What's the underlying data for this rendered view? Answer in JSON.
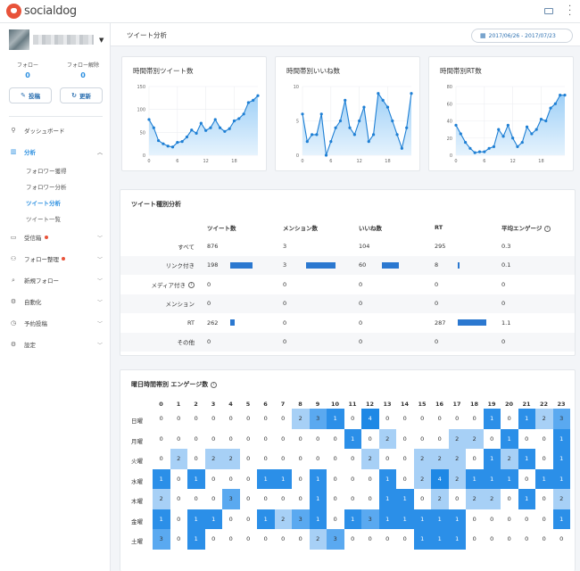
{
  "app": {
    "logo_text": "socialdog"
  },
  "topbar": {
    "icons": [
      "keyboard-icon",
      "more-vertical-icon"
    ]
  },
  "profile": {
    "name": ""
  },
  "stats": [
    {
      "label": "フォロー",
      "value": "0"
    },
    {
      "label": "フォロー解除",
      "value": "0"
    }
  ],
  "actions": {
    "post_label": "投稿",
    "refresh_label": "更新"
  },
  "nav": {
    "dashboard": "ダッシュボード",
    "analysis": "分析",
    "sub": [
      "フォロワー獲得",
      "フォロワー分析",
      "ツイート分析",
      "ツイート一覧"
    ],
    "inbox": "受信箱",
    "follow_manage": "フォロー整理",
    "new_follow": "新規フォロー",
    "automation": "自動化",
    "scheduled": "予約投稿",
    "settings": "設定"
  },
  "header": {
    "title": "ツイート分析",
    "date_range": "2017/06/26 - 2017/07/23"
  },
  "charts_meta": [
    {
      "title": "時間帯別ツイート数",
      "ylim": [
        0,
        150
      ],
      "yticks": [
        0,
        50,
        100,
        150
      ]
    },
    {
      "title": "時間帯別いいね数",
      "ylim": [
        0,
        10
      ],
      "yticks": [
        0,
        5,
        10
      ]
    },
    {
      "title": "時間帯別RT数",
      "ylim": [
        0,
        80
      ],
      "yticks": [
        0,
        20,
        40,
        60,
        80
      ]
    }
  ],
  "chart_data": [
    {
      "type": "area",
      "title": "時間帯別ツイート数",
      "xticks": [
        0,
        6,
        12,
        18
      ],
      "ylim": [
        0,
        150
      ],
      "x": [
        0,
        1,
        2,
        3,
        4,
        5,
        6,
        7,
        8,
        9,
        10,
        11,
        12,
        13,
        14,
        15,
        16,
        17,
        18,
        19,
        20,
        21,
        22,
        23
      ],
      "y": [
        78,
        60,
        32,
        25,
        20,
        18,
        28,
        30,
        40,
        55,
        48,
        70,
        54,
        60,
        78,
        60,
        52,
        58,
        75,
        80,
        90,
        115,
        120,
        130
      ]
    },
    {
      "type": "area",
      "title": "時間帯別いいね数",
      "xticks": [
        0,
        6,
        12,
        18
      ],
      "ylim": [
        0,
        10
      ],
      "x": [
        0,
        1,
        2,
        3,
        4,
        5,
        6,
        7,
        8,
        9,
        10,
        11,
        12,
        13,
        14,
        15,
        16,
        17,
        18,
        19,
        20,
        21,
        22,
        23
      ],
      "y": [
        6,
        2,
        3,
        3,
        6,
        0,
        2,
        4,
        5,
        8,
        4,
        3,
        5,
        7,
        2,
        3,
        9,
        8,
        7,
        5,
        3,
        1,
        4,
        9
      ]
    },
    {
      "type": "area",
      "title": "時間帯別RT数",
      "xticks": [
        0,
        6,
        12,
        18
      ],
      "ylim": [
        0,
        80
      ],
      "x": [
        0,
        1,
        2,
        3,
        4,
        5,
        6,
        7,
        8,
        9,
        10,
        11,
        12,
        13,
        14,
        15,
        16,
        17,
        18,
        19,
        20,
        21,
        22,
        23
      ],
      "y": [
        35,
        25,
        15,
        8,
        3,
        4,
        4,
        8,
        10,
        30,
        22,
        35,
        20,
        10,
        15,
        33,
        25,
        30,
        42,
        40,
        55,
        60,
        70,
        70
      ]
    }
  ],
  "type_table": {
    "title": "ツイート種別分析",
    "columns": [
      "ツイート数",
      "メンション数",
      "いいね数",
      "RT",
      "平均エンゲージ"
    ],
    "rows": [
      {
        "label": "すべて",
        "values": [
          "876",
          "3",
          "104",
          "295",
          "0.3"
        ],
        "bars": [
          0,
          0,
          0,
          0
        ]
      },
      {
        "label": "リンク付き",
        "values": [
          "198",
          "3",
          "60",
          "8",
          "0.1"
        ],
        "bars": [
          0.75,
          1,
          0.58,
          0.03
        ]
      },
      {
        "label": "メディア付き",
        "info": true,
        "values": [
          "0",
          "0",
          "0",
          "0",
          "0"
        ],
        "bars": [
          0,
          0,
          0,
          0
        ]
      },
      {
        "label": "メンション",
        "values": [
          "0",
          "0",
          "0",
          "0",
          "0"
        ],
        "bars": [
          0,
          0,
          0,
          0
        ]
      },
      {
        "label": "RT",
        "values": [
          "262",
          "0",
          "0",
          "287",
          "1.1"
        ],
        "bars": [
          0.16,
          0,
          0,
          0.97
        ]
      },
      {
        "label": "その他",
        "values": [
          "0",
          "0",
          "0",
          "0",
          "0"
        ],
        "bars": [
          0,
          0,
          0,
          0
        ]
      }
    ]
  },
  "heatmap": {
    "title": "曜日時間帯別 エンゲージ数",
    "hours": [
      "0",
      "1",
      "2",
      "3",
      "4",
      "5",
      "6",
      "7",
      "8",
      "9",
      "10",
      "11",
      "12",
      "13",
      "14",
      "15",
      "16",
      "17",
      "18",
      "19",
      "20",
      "21",
      "22",
      "23"
    ],
    "days": [
      "日曜",
      "月曜",
      "火曜",
      "水曜",
      "木曜",
      "金曜",
      "土曜"
    ],
    "values": [
      [
        0,
        0,
        0,
        0,
        0,
        0,
        0,
        0,
        2,
        3,
        1,
        0,
        4,
        0,
        0,
        0,
        0,
        0,
        0,
        1,
        0,
        1,
        2,
        3
      ],
      [
        0,
        0,
        0,
        0,
        0,
        0,
        0,
        0,
        0,
        0,
        0,
        1,
        0,
        2,
        0,
        0,
        0,
        2,
        2,
        0,
        1,
        0,
        0,
        1
      ],
      [
        0,
        2,
        0,
        2,
        2,
        0,
        0,
        0,
        0,
        0,
        0,
        0,
        2,
        0,
        0,
        2,
        2,
        2,
        0,
        1,
        2,
        1,
        0,
        1
      ],
      [
        1,
        0,
        1,
        0,
        0,
        0,
        1,
        1,
        0,
        1,
        0,
        0,
        0,
        1,
        0,
        2,
        4,
        2,
        1,
        1,
        1,
        0,
        1,
        1
      ],
      [
        2,
        0,
        0,
        0,
        3,
        0,
        0,
        0,
        0,
        1,
        0,
        0,
        0,
        1,
        1,
        0,
        2,
        0,
        2,
        2,
        0,
        1,
        0,
        2
      ],
      [
        1,
        0,
        1,
        1,
        0,
        0,
        1,
        2,
        3,
        1,
        0,
        1,
        3,
        1,
        1,
        1,
        1,
        1,
        0,
        0,
        0,
        0,
        0,
        1
      ],
      [
        3,
        0,
        1,
        0,
        0,
        0,
        0,
        0,
        0,
        2,
        3,
        0,
        0,
        0,
        0,
        1,
        1,
        1,
        0,
        0,
        0,
        0,
        0,
        0
      ]
    ],
    "colors": [
      "#ffffff",
      "#2b8fe8",
      "#a7d0f6",
      "#5aa9f0",
      "#1e88e5"
    ]
  }
}
